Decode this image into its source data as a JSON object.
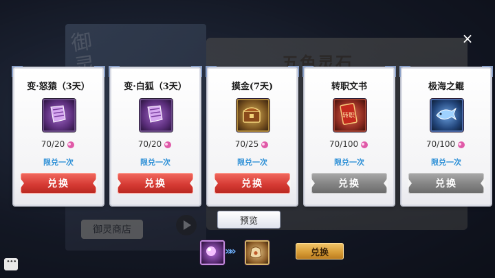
{
  "background": {
    "title": "五色灵石",
    "shop_label": "御灵商店",
    "calligraphy": "御灵"
  },
  "close": {
    "icon": "close-icon",
    "symbol": "×"
  },
  "cards": [
    {
      "title": "变·怒猿（3天）",
      "count": "70/20",
      "limit": "限兑一次",
      "button": "兑换",
      "enabled": true,
      "icon": "scroll-purple-icon"
    },
    {
      "title": "变·白狐（3天）",
      "count": "70/20",
      "limit": "限兑一次",
      "button": "兑换",
      "enabled": true,
      "icon": "scroll-purple-icon"
    },
    {
      "title": "摸金(7天)",
      "count": "70/25",
      "limit": "限兑一次",
      "button": "兑换",
      "enabled": true,
      "icon": "treasure-chest-icon"
    },
    {
      "title": "转职文书",
      "count": "70/100",
      "limit": "限兑一次",
      "button": "兑换",
      "enabled": false,
      "icon": "job-change-document-icon",
      "icon_text": "转职"
    },
    {
      "title": "极海之鲲",
      "count": "70/100",
      "limit": "限兑一次",
      "button": "兑换",
      "enabled": false,
      "icon": "sea-whale-icon"
    }
  ],
  "preview_label": "预览",
  "bottom": {
    "source_icon": "spirit-stone-icon",
    "arrow_text": "»»",
    "target_icon": "pouch-icon",
    "exchange_label": "兑换"
  },
  "colors": {
    "limit_text": "#2c8fd6",
    "button_active": "#d73b35",
    "button_disabled": "#838383",
    "bottom_button": "#d59a34"
  }
}
